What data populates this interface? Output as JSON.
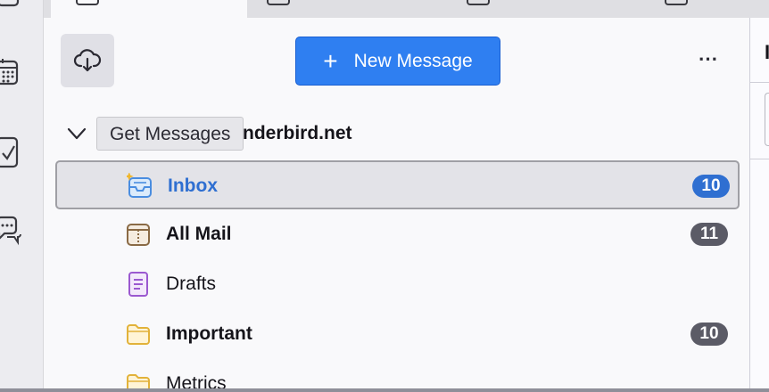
{
  "folder_pane": {
    "new_message_label": "New Message",
    "new_message_plus": "+",
    "more_label": "⋯",
    "get_messages_tooltip": "Get Messages",
    "account_name_visible": "nderbird.net"
  },
  "folders": [
    {
      "label": "Inbox",
      "count": "10",
      "icon": "inbox-icon",
      "selected": true
    },
    {
      "label": "All Mail",
      "count": "11",
      "icon": "archive-icon"
    },
    {
      "label": "Drafts",
      "count": "",
      "icon": "drafts-icon"
    },
    {
      "label": "Important",
      "count": "10",
      "icon": "folder-icon"
    },
    {
      "label": "Metrics",
      "count": "",
      "icon": "folder-icon"
    }
  ],
  "thread_pane": {
    "partial_heading": "I"
  },
  "colors": {
    "accent": "#2f7ff1",
    "inbox_blue": "#2f6fd1",
    "badge_gray": "#5b5b66",
    "folder_yellow": "#f0c23b",
    "drafts_purple": "#9b59d0",
    "archive_brown": "#8a6a45"
  }
}
